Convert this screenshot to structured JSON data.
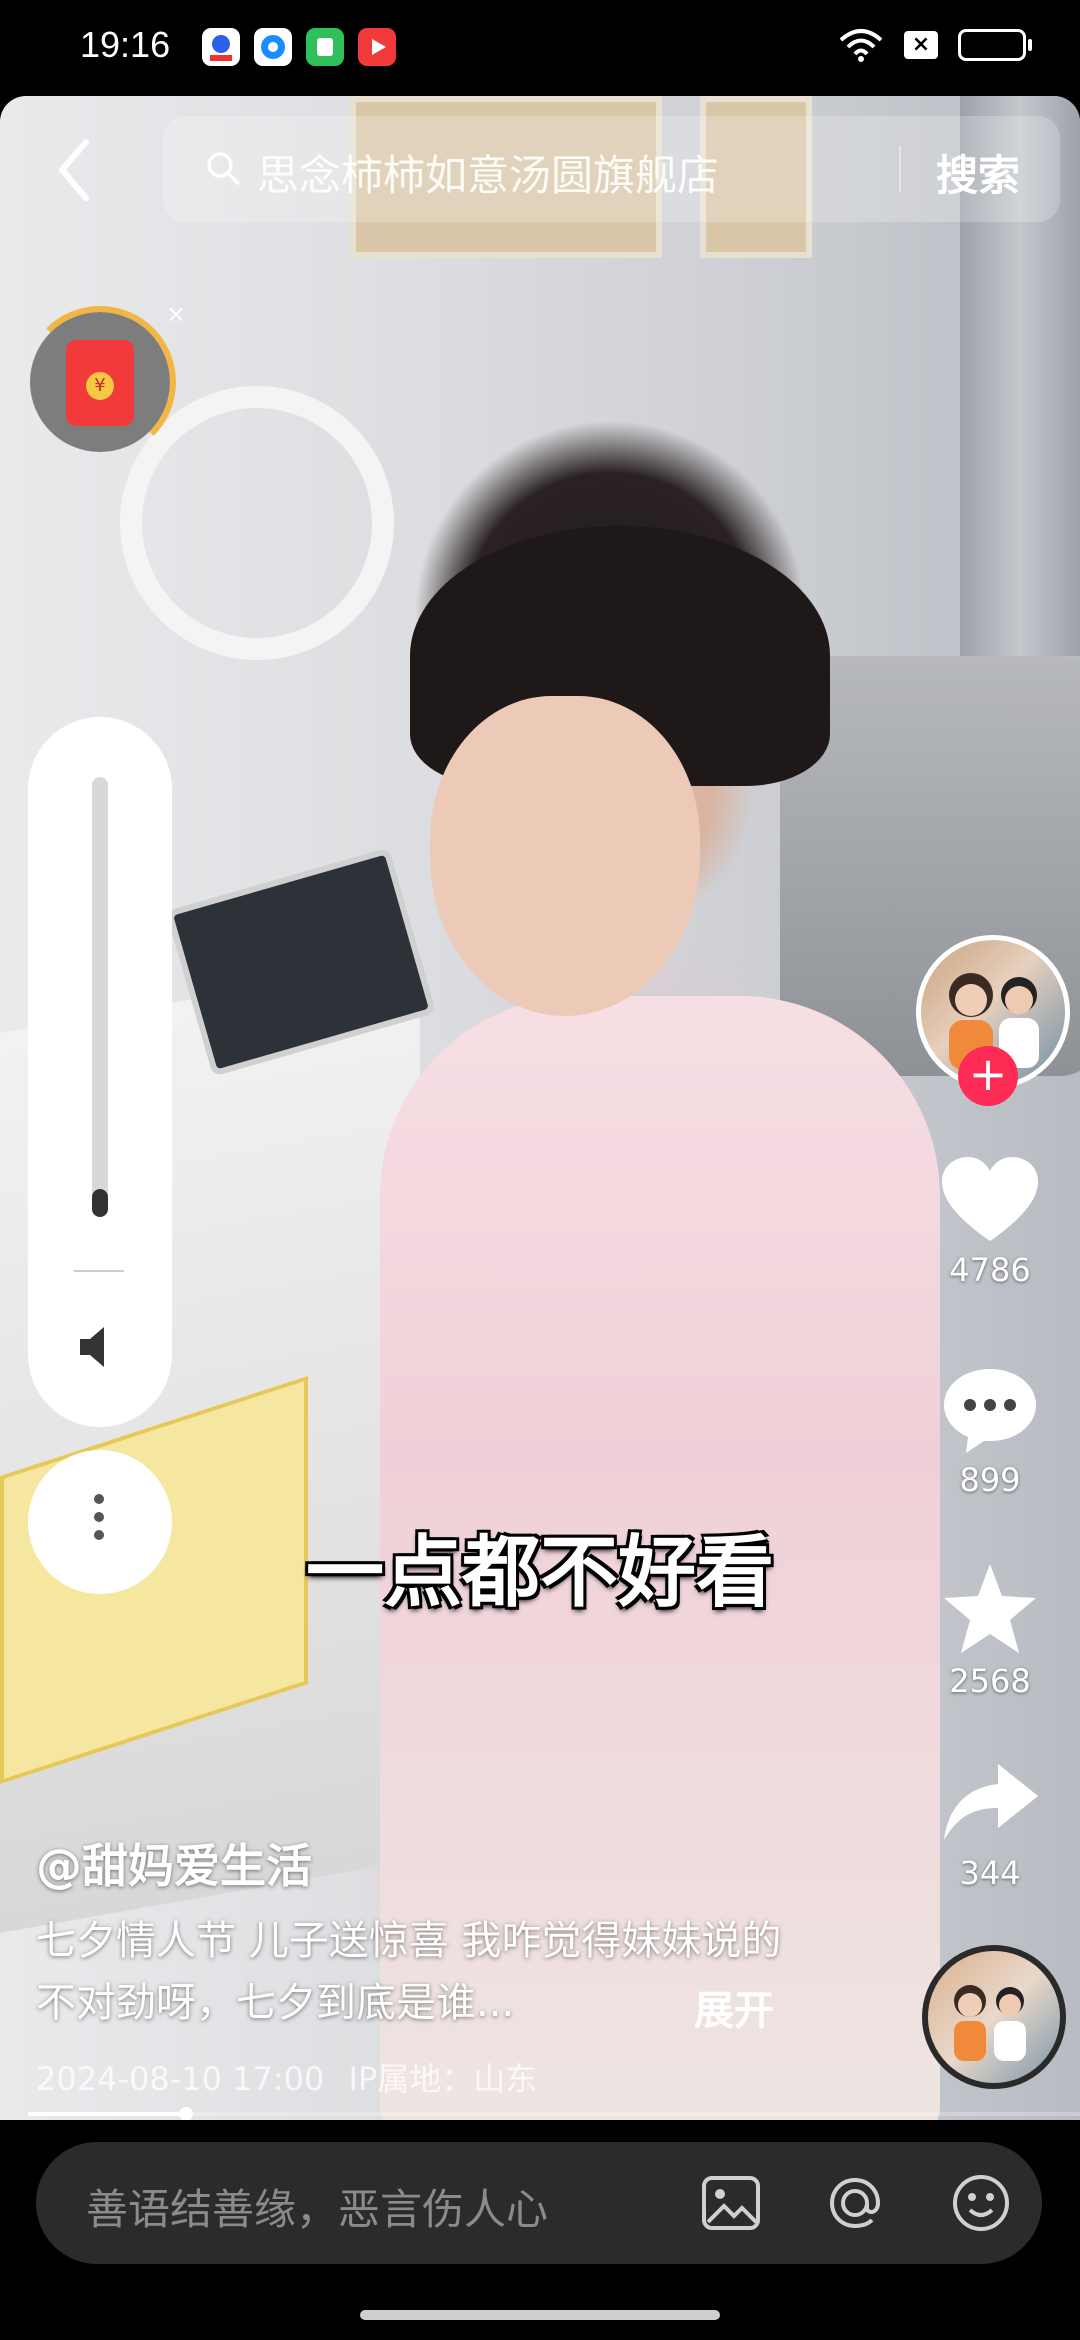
{
  "status_bar": {
    "time": "19:16",
    "apps": [
      {
        "name": "baidu-app-icon",
        "color": "#ffffff"
      },
      {
        "name": "circle-app-icon",
        "color": "#ffffff"
      },
      {
        "name": "green-app-icon",
        "color": "#2fbf5b"
      },
      {
        "name": "red-play-app-icon",
        "color": "#f23a3a"
      }
    ]
  },
  "search": {
    "placeholder": "思念柿柿如意汤圆旗舰店",
    "button_label": "搜索"
  },
  "video": {
    "caption": "一点都不好看"
  },
  "volume": {
    "level": 0.04
  },
  "actions": {
    "likes": "4786",
    "comments": "899",
    "favorites": "2568",
    "shares": "344"
  },
  "post": {
    "author": "@甜妈爱生活",
    "description": "七夕情人节 儿子送惊喜 我咋觉得妹妹说的不对劲呀，七夕到底是谁...",
    "expand_label": "展开",
    "date": "2024-08-10 17:00",
    "ip_location": "IP属地：山东",
    "progress": 0.15
  },
  "comment_bar": {
    "placeholder": "善语结善缘，恶言伤人心"
  },
  "colors": {
    "accent": "#fe2c55",
    "bar_bg": "#2b2b2b"
  }
}
